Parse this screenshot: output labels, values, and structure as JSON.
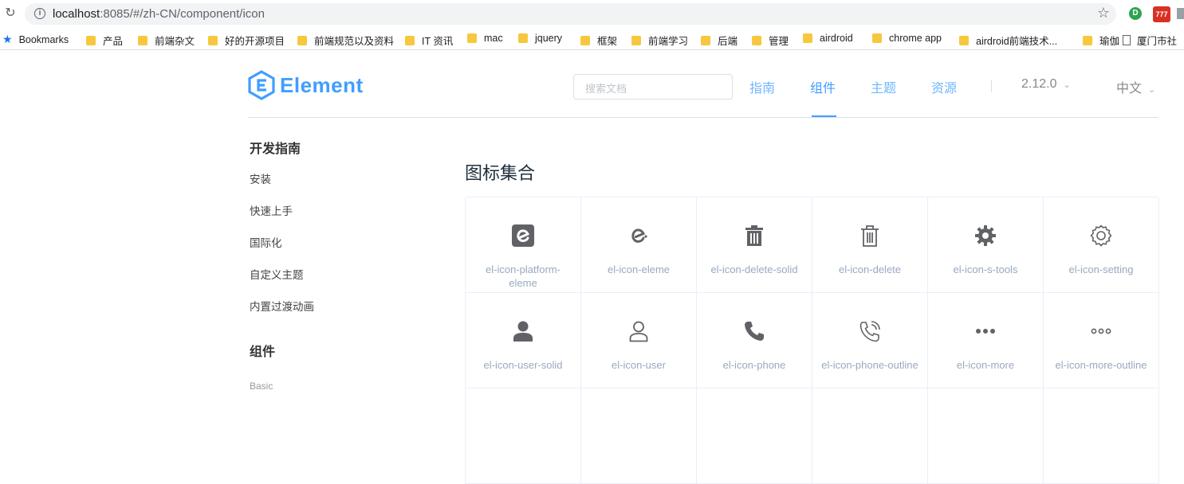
{
  "browser": {
    "url_host": "localhost",
    "url_rest": ":8085/#/zh-CN/component/icon",
    "bookmarks_label": "Bookmarks",
    "bookmarks": [
      "产品",
      "前端杂文",
      "好的开源项目",
      "前端规范以及资料",
      "IT 资讯",
      "mac",
      "jquery",
      "框架",
      "前端学习",
      "后端",
      "管理",
      "airdroid",
      "chrome app",
      "airdroid前端技术...",
      "瑜伽",
      "厦门市社"
    ]
  },
  "header": {
    "logo_text": "Element",
    "search_placeholder": "搜索文档",
    "nav": [
      "指南",
      "组件",
      "主题",
      "资源"
    ],
    "active_nav": "组件",
    "version": "2.12.0",
    "language": "中文"
  },
  "sidebar": {
    "group1": "开发指南",
    "items": [
      "安装",
      "快速上手",
      "国际化",
      "自定义主题",
      "内置过渡动画"
    ],
    "group2": "组件",
    "sub": "Basic"
  },
  "main": {
    "title": "图标集合",
    "icons": [
      {
        "name": "el-icon-platform-eleme",
        "icon": "platform-eleme-icon"
      },
      {
        "name": "el-icon-eleme",
        "icon": "eleme-icon"
      },
      {
        "name": "el-icon-delete-solid",
        "icon": "delete-solid-icon"
      },
      {
        "name": "el-icon-delete",
        "icon": "delete-icon"
      },
      {
        "name": "el-icon-s-tools",
        "icon": "tools-icon"
      },
      {
        "name": "el-icon-setting",
        "icon": "setting-icon"
      },
      {
        "name": "el-icon-user-solid",
        "icon": "user-solid-icon"
      },
      {
        "name": "el-icon-user",
        "icon": "user-icon"
      },
      {
        "name": "el-icon-phone",
        "icon": "phone-icon"
      },
      {
        "name": "el-icon-phone-outline",
        "icon": "phone-outline-icon"
      },
      {
        "name": "el-icon-more",
        "icon": "more-icon"
      },
      {
        "name": "el-icon-more-outline",
        "icon": "more-outline-icon"
      }
    ]
  },
  "colors": {
    "brand": "#409eff",
    "icon": "#606266",
    "icon_label": "#99a9bf"
  }
}
